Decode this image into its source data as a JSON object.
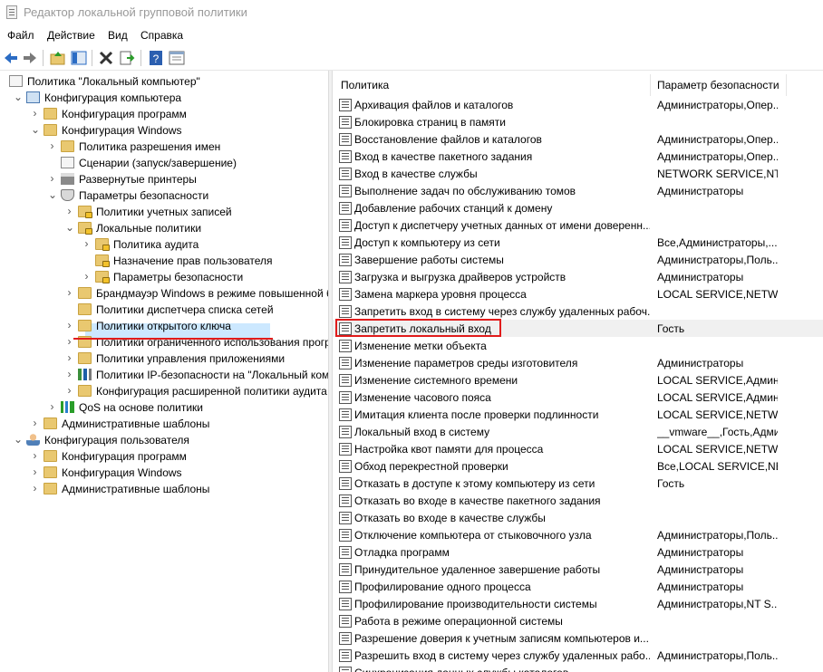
{
  "window": {
    "title": "Редактор локальной групповой политики"
  },
  "menu": [
    "Файл",
    "Действие",
    "Вид",
    "Справка"
  ],
  "tree": [
    {
      "label": "Политика \"Локальный компьютер\"",
      "indent": 0,
      "icon": "document-icon",
      "toggle": ""
    },
    {
      "label": "Конфигурация компьютера",
      "indent": 1,
      "icon": "computer-icon",
      "toggle": "v"
    },
    {
      "label": "Конфигурация программ",
      "indent": 2,
      "icon": "folder-icon",
      "toggle": ">"
    },
    {
      "label": "Конфигурация Windows",
      "indent": 2,
      "icon": "folder-icon",
      "toggle": "v"
    },
    {
      "label": "Политика разрешения имен",
      "indent": 3,
      "icon": "folder-icon",
      "toggle": ">"
    },
    {
      "label": "Сценарии (запуск/завершение)",
      "indent": 3,
      "icon": "script-icon",
      "toggle": ""
    },
    {
      "label": "Развернутые принтеры",
      "indent": 3,
      "icon": "printer-icon",
      "toggle": ">"
    },
    {
      "label": "Параметры безопасности",
      "indent": 3,
      "icon": "security-icon",
      "toggle": "v"
    },
    {
      "label": "Политики учетных записей",
      "indent": 4,
      "icon": "lock-folder-icon",
      "toggle": ">"
    },
    {
      "label": "Локальные политики",
      "indent": 4,
      "icon": "lock-folder-icon",
      "toggle": "v"
    },
    {
      "label": "Политика аудита",
      "indent": 5,
      "icon": "lock-folder-icon",
      "toggle": ">"
    },
    {
      "label": "Назначение прав пользователя",
      "indent": 5,
      "icon": "lock-folder-icon",
      "toggle": "",
      "selected": true
    },
    {
      "label": "Параметры безопасности",
      "indent": 5,
      "icon": "lock-folder-icon",
      "toggle": ">"
    },
    {
      "label": "Брандмауэр Windows в режиме повышенной б",
      "indent": 4,
      "icon": "folder-icon",
      "toggle": ">"
    },
    {
      "label": "Политики диспетчера списка сетей",
      "indent": 4,
      "icon": "folder-icon",
      "toggle": ""
    },
    {
      "label": "Политики открытого ключа",
      "indent": 4,
      "icon": "folder-icon",
      "toggle": ">"
    },
    {
      "label": "Политики ограниченного использования прогр",
      "indent": 4,
      "icon": "folder-icon",
      "toggle": ">"
    },
    {
      "label": "Политики управления приложениями",
      "indent": 4,
      "icon": "folder-icon",
      "toggle": ">"
    },
    {
      "label": "Политики IP-безопасности на \"Локальный компь",
      "indent": 4,
      "icon": "ipsec-icon",
      "toggle": ">"
    },
    {
      "label": "Конфигурация расширенной политики аудита",
      "indent": 4,
      "icon": "folder-icon",
      "toggle": ">"
    },
    {
      "label": "QoS на основе политики",
      "indent": 3,
      "icon": "qos-icon",
      "toggle": ">"
    },
    {
      "label": "Административные шаблоны",
      "indent": 2,
      "icon": "folder-icon",
      "toggle": ">"
    },
    {
      "label": "Конфигурация пользователя",
      "indent": 1,
      "icon": "user-icon",
      "toggle": "v"
    },
    {
      "label": "Конфигурация программ",
      "indent": 2,
      "icon": "folder-icon",
      "toggle": ">"
    },
    {
      "label": "Конфигурация Windows",
      "indent": 2,
      "icon": "folder-icon",
      "toggle": ">"
    },
    {
      "label": "Административные шаблоны",
      "indent": 2,
      "icon": "folder-icon",
      "toggle": ">"
    }
  ],
  "list": {
    "columns": [
      "Политика",
      "Параметр безопасности"
    ],
    "rows": [
      {
        "name": "Архивация файлов и каталогов",
        "value": "Администраторы,Опер..."
      },
      {
        "name": "Блокировка страниц в памяти",
        "value": ""
      },
      {
        "name": "Восстановление файлов и каталогов",
        "value": "Администраторы,Опер..."
      },
      {
        "name": "Вход в качестве пакетного задания",
        "value": "Администраторы,Опер..."
      },
      {
        "name": "Вход в качестве службы",
        "value": "NETWORK SERVICE,NT ..."
      },
      {
        "name": "Выполнение задач по обслуживанию томов",
        "value": "Администраторы"
      },
      {
        "name": "Добавление рабочих станций к домену",
        "value": ""
      },
      {
        "name": "Доступ к диспетчеру учетных данных от имени доверенн...",
        "value": ""
      },
      {
        "name": "Доступ к компьютеру из сети",
        "value": "Все,Администраторы,..."
      },
      {
        "name": "Завершение работы системы",
        "value": "Администраторы,Поль..."
      },
      {
        "name": "Загрузка и выгрузка драйверов устройств",
        "value": "Администраторы"
      },
      {
        "name": "Замена маркера уровня процесса",
        "value": "LOCAL SERVICE,NETWO..."
      },
      {
        "name": "Запретить вход в систему через службу удаленных рабоч...",
        "value": ""
      },
      {
        "name": "Запретить локальный вход",
        "value": "Гость",
        "highlight": true
      },
      {
        "name": "Изменение метки объекта",
        "value": ""
      },
      {
        "name": "Изменение параметров среды изготовителя",
        "value": "Администраторы"
      },
      {
        "name": "Изменение системного времени",
        "value": "LOCAL SERVICE,Админ..."
      },
      {
        "name": "Изменение часового пояса",
        "value": "LOCAL SERVICE,Админ..."
      },
      {
        "name": "Имитация клиента после проверки подлинности",
        "value": "LOCAL SERVICE,NETWO..."
      },
      {
        "name": "Локальный вход в систему",
        "value": "__vmware__,Гость,Адми..."
      },
      {
        "name": "Настройка квот памяти для процесса",
        "value": "LOCAL SERVICE,NETWO..."
      },
      {
        "name": "Обход перекрестной проверки",
        "value": "Все,LOCAL SERVICE,NE..."
      },
      {
        "name": "Отказать в доступе к этому компьютеру из сети",
        "value": "Гость"
      },
      {
        "name": "Отказать во входе в качестве пакетного задания",
        "value": ""
      },
      {
        "name": "Отказать во входе в качестве службы",
        "value": ""
      },
      {
        "name": "Отключение компьютера от стыковочного узла",
        "value": "Администраторы,Поль..."
      },
      {
        "name": "Отладка программ",
        "value": "Администраторы"
      },
      {
        "name": "Принудительное удаленное завершение работы",
        "value": "Администраторы"
      },
      {
        "name": "Профилирование одного процесса",
        "value": "Администраторы"
      },
      {
        "name": "Профилирование производительности системы",
        "value": "Администраторы,NT S..."
      },
      {
        "name": "Работа в режиме операционной системы",
        "value": ""
      },
      {
        "name": "Разрешение доверия к учетным записям компьютеров и...",
        "value": ""
      },
      {
        "name": "Разрешить вход в систему через службу удаленных рабо...",
        "value": "Администраторы,Поль..."
      },
      {
        "name": "Синхронизация данных службы каталогов",
        "value": ""
      }
    ]
  }
}
